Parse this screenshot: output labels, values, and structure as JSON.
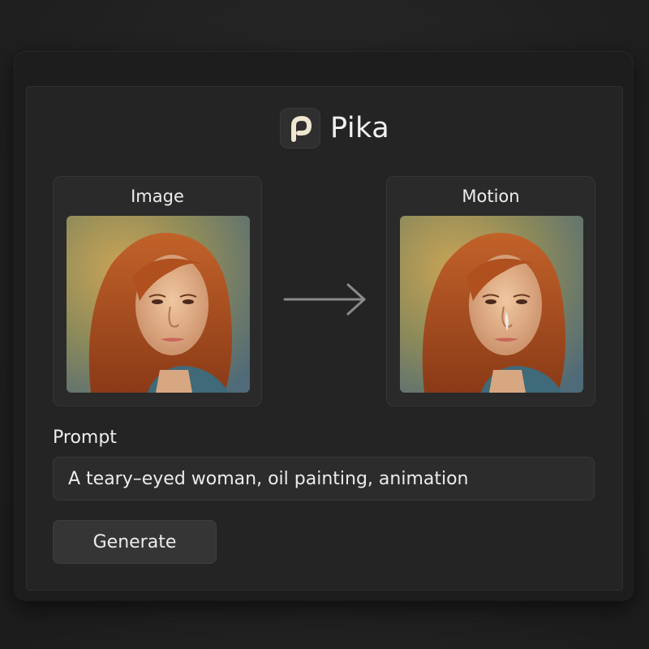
{
  "app": {
    "name": "Pika",
    "logo_icon": "pika-logo-icon"
  },
  "panels": {
    "image": {
      "title": "Image",
      "icon": "portrait-painting"
    },
    "motion": {
      "title": "Motion",
      "icon": "portrait-painting-with-tear"
    },
    "arrow_icon": "arrow-right-icon"
  },
  "prompt": {
    "label": "Prompt",
    "value": "A teary–eyed woman, oil painting, animation"
  },
  "actions": {
    "generate_label": "Generate"
  },
  "colors": {
    "background": "#222222",
    "panel": "#2a2a2a",
    "accent_logo": "#efe6cf",
    "hair": "#b4521f"
  }
}
